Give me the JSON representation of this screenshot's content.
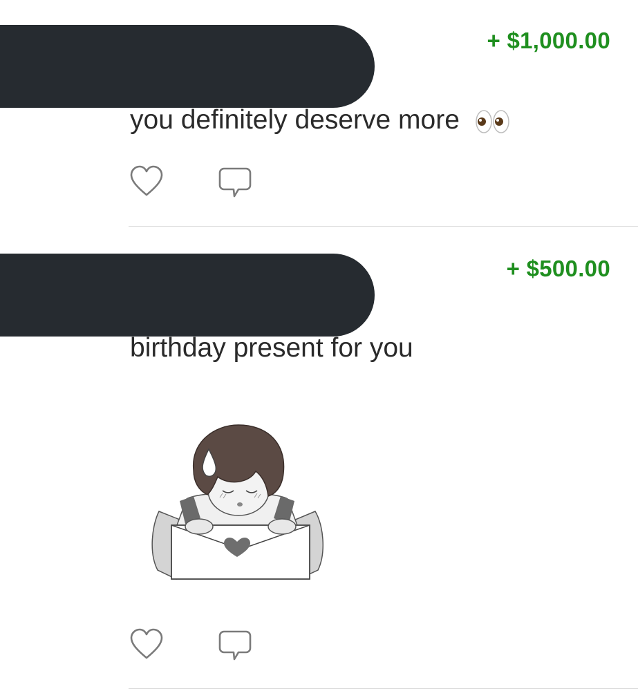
{
  "feed": {
    "transactions": [
      {
        "amount": "+ $1,000.00",
        "note": "you definitely deserve more",
        "note_emoji": "eyes-emoji",
        "actions": [
          "heart-icon",
          "comment-icon"
        ]
      },
      {
        "amount": "+ $500.00",
        "note": "birthday present for you",
        "attachment": "sticker-boy-with-heart-envelope",
        "actions": [
          "heart-icon",
          "comment-icon"
        ]
      }
    ]
  },
  "colors": {
    "amount_green": "#1f8f1f",
    "redaction": "#262b30",
    "divider": "#dcdcdc",
    "text": "#2a2a2a",
    "icon_stroke": "#7a7a7a"
  }
}
